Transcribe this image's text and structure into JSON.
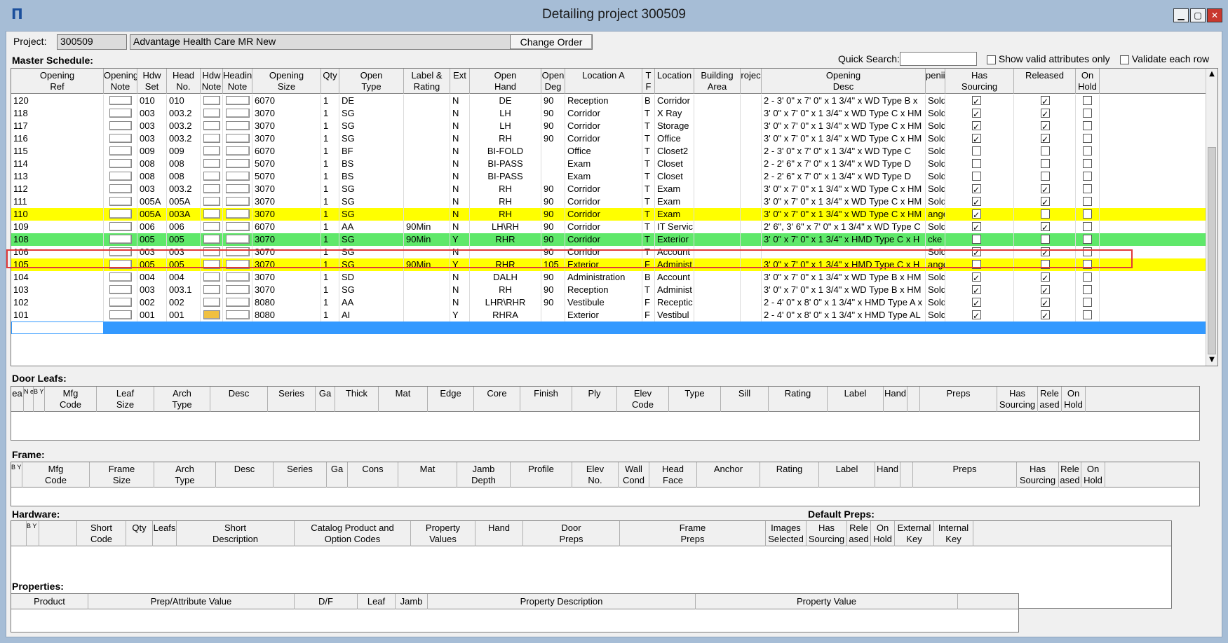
{
  "window": {
    "title": "Detailing project 300509",
    "app_icon": "app-icon",
    "buttons": [
      "minimize",
      "maximize",
      "close"
    ]
  },
  "project": {
    "label": "Project:",
    "number": "300509",
    "name": "Advantage Health Care MR New",
    "change_order_label": "Change Order"
  },
  "master": {
    "label": "Master Schedule:",
    "quick_search_label": "Quick Search:",
    "quick_search_value": "",
    "show_valid_label": "Show valid attributes only",
    "validate_label": "Validate each row",
    "headers": {
      "opening_ref": [
        "Opening",
        "Ref"
      ],
      "opening_note": [
        "Opening",
        "Note"
      ],
      "hdw_set": [
        "Hdw",
        "Set"
      ],
      "head_no": [
        "Head",
        "No."
      ],
      "hdw_note": [
        "Hdw",
        "Note"
      ],
      "heading_note": [
        "Heading",
        "Note"
      ],
      "opening_size": [
        "Opening",
        "Size"
      ],
      "qty": [
        "",
        "Qty"
      ],
      "open_type": [
        "Open",
        "Type"
      ],
      "label_rating": [
        "Label &",
        "Rating"
      ],
      "ext": [
        "",
        "Ext"
      ],
      "open_hand": [
        "Open",
        "Hand"
      ],
      "open_deg": [
        "Open",
        "Deg"
      ],
      "location_a": [
        "",
        "Location A"
      ],
      "tf": [
        "T",
        "F"
      ],
      "location": [
        "",
        "Location"
      ],
      "building_area": [
        "Building",
        "Area"
      ],
      "proj": [
        "rojec",
        ""
      ],
      "opening_desc": [
        "Opening",
        "Desc"
      ],
      "openi": [
        "penii",
        ""
      ],
      "has_sourcing": [
        "Has",
        "Sourcing"
      ],
      "released": [
        "",
        "Released"
      ],
      "on_hold": [
        "On",
        "Hold"
      ]
    },
    "rows": [
      {
        "ref": "120",
        "set": "010",
        "head": "010",
        "size": "6070",
        "qty": "1",
        "type": "DE",
        "label": "",
        "ext": "N",
        "hand": "DE",
        "deg": "90",
        "loca": "Reception",
        "tf": "B",
        "loc": "Corridor",
        "desc": "2 - 3' 0\" x 7' 0\" x 1 3/4\" x WD Type B x",
        "stat": "Sold",
        "src": true,
        "rel": true,
        "hold": false,
        "style": ""
      },
      {
        "ref": "118",
        "set": "003",
        "head": "003.2",
        "size": "3070",
        "qty": "1",
        "type": "SG",
        "label": "",
        "ext": "N",
        "hand": "LH",
        "deg": "90",
        "loca": "Corridor",
        "tf": "T",
        "loc": "X Ray",
        "desc": "3' 0\" x 7' 0\" x 1 3/4\" x WD Type C x HM",
        "stat": "Sold",
        "src": true,
        "rel": true,
        "hold": false,
        "style": ""
      },
      {
        "ref": "117",
        "set": "003",
        "head": "003.2",
        "size": "3070",
        "qty": "1",
        "type": "SG",
        "label": "",
        "ext": "N",
        "hand": "LH",
        "deg": "90",
        "loca": "Corridor",
        "tf": "T",
        "loc": "Storage",
        "desc": "3' 0\" x 7' 0\" x 1 3/4\" x WD Type C x HM",
        "stat": "Sold",
        "src": true,
        "rel": true,
        "hold": false,
        "style": ""
      },
      {
        "ref": "116",
        "set": "003",
        "head": "003.2",
        "size": "3070",
        "qty": "1",
        "type": "SG",
        "label": "",
        "ext": "N",
        "hand": "RH",
        "deg": "90",
        "loca": "Corridor",
        "tf": "T",
        "loc": "Office",
        "desc": "3' 0\" x 7' 0\" x 1 3/4\" x WD Type C x HM",
        "stat": "Sold",
        "src": true,
        "rel": true,
        "hold": false,
        "style": ""
      },
      {
        "ref": "115",
        "set": "009",
        "head": "009",
        "size": "6070",
        "qty": "1",
        "type": "BF",
        "label": "",
        "ext": "N",
        "hand": "BI-FOLD",
        "deg": "",
        "loca": "Office",
        "tf": "T",
        "loc": "Closet2",
        "desc": "2 - 3' 0\" x 7' 0\" x 1 3/4\" x WD Type C",
        "stat": "Sold",
        "src": false,
        "rel": false,
        "hold": false,
        "style": ""
      },
      {
        "ref": "114",
        "set": "008",
        "head": "008",
        "size": "5070",
        "qty": "1",
        "type": "BS",
        "label": "",
        "ext": "N",
        "hand": "BI-PASS",
        "deg": "",
        "loca": "Exam",
        "tf": "T",
        "loc": "Closet",
        "desc": "2 - 2' 6\" x 7' 0\" x 1 3/4\" x WD Type D",
        "stat": "Sold",
        "src": false,
        "rel": false,
        "hold": false,
        "style": ""
      },
      {
        "ref": "113",
        "set": "008",
        "head": "008",
        "size": "5070",
        "qty": "1",
        "type": "BS",
        "label": "",
        "ext": "N",
        "hand": "BI-PASS",
        "deg": "",
        "loca": "Exam",
        "tf": "T",
        "loc": "Closet",
        "desc": "2 - 2' 6\" x 7' 0\" x 1 3/4\" x WD Type D",
        "stat": "Sold",
        "src": false,
        "rel": false,
        "hold": false,
        "style": ""
      },
      {
        "ref": "112",
        "set": "003",
        "head": "003.2",
        "size": "3070",
        "qty": "1",
        "type": "SG",
        "label": "",
        "ext": "N",
        "hand": "RH",
        "deg": "90",
        "loca": "Corridor",
        "tf": "T",
        "loc": "Exam",
        "desc": "3' 0\" x 7' 0\" x 1 3/4\" x WD Type C x HM",
        "stat": "Sold",
        "src": true,
        "rel": true,
        "hold": false,
        "style": ""
      },
      {
        "ref": "111",
        "set": "005A",
        "head": "005A",
        "size": "3070",
        "qty": "1",
        "type": "SG",
        "label": "",
        "ext": "N",
        "hand": "RH",
        "deg": "90",
        "loca": "Corridor",
        "tf": "T",
        "loc": "Exam",
        "desc": "3' 0\" x 7' 0\" x 1 3/4\" x WD Type C x HM",
        "stat": "Sold",
        "src": true,
        "rel": true,
        "hold": false,
        "style": ""
      },
      {
        "ref": "110",
        "set": "005A",
        "head": "003A",
        "size": "3070",
        "qty": "1",
        "type": "SG",
        "label": "",
        "ext": "N",
        "hand": "RH",
        "deg": "90",
        "loca": "Corridor",
        "tf": "T",
        "loc": "Exam",
        "desc": "3' 0\" x 7' 0\" x 1 3/4\" x WD Type C x HM",
        "stat": "ange",
        "src": true,
        "rel": false,
        "hold": false,
        "style": "yellow"
      },
      {
        "ref": "109",
        "set": "006",
        "head": "006",
        "size": "6070",
        "qty": "1",
        "type": "AA",
        "label": "90Min",
        "ext": "N",
        "hand": "LH\\RH",
        "deg": "90",
        "loca": "Corridor",
        "tf": "T",
        "loc": "IT Servic",
        "desc": "2' 6\", 3' 6\" x 7' 0\" x 1 3/4\" x WD Type C",
        "stat": "Sold",
        "src": true,
        "rel": true,
        "hold": false,
        "style": ""
      },
      {
        "ref": "108",
        "set": "005",
        "head": "005",
        "size": "3070",
        "qty": "1",
        "type": "SG",
        "label": "90Min",
        "ext": "Y",
        "hand": "RHR",
        "deg": "90",
        "loca": "Corridor",
        "tf": "T",
        "loc": "Exterior",
        "desc": "3' 0\" x 7' 0\" x 1 3/4\" x HMD Type C x H",
        "stat": "cke",
        "src": false,
        "rel": false,
        "hold": false,
        "style": "green"
      },
      {
        "ref": "106",
        "set": "003",
        "head": "003",
        "size": "3070",
        "qty": "1",
        "type": "SG",
        "label": "",
        "ext": "N",
        "hand": "",
        "deg": "90",
        "loca": "Corridor",
        "tf": "T",
        "loc": "Account",
        "desc": "",
        "stat": "Sold",
        "src": true,
        "rel": true,
        "hold": false,
        "style": ""
      },
      {
        "ref": "105",
        "set": "005",
        "head": "005",
        "size": "3070",
        "qty": "1",
        "type": "SG",
        "label": "90Min",
        "ext": "Y",
        "hand": "RHR",
        "deg": "105",
        "loca": "Exterior",
        "tf": "F",
        "loc": "Administ",
        "desc": "3' 0\" x 7' 0\" x 1 3/4\" x HMD Type C x H",
        "stat": "ange",
        "src": false,
        "rel": false,
        "hold": false,
        "style": "yellow"
      },
      {
        "ref": "104",
        "set": "004",
        "head": "004",
        "size": "3070",
        "qty": "1",
        "type": "SD",
        "label": "",
        "ext": "N",
        "hand": "DALH",
        "deg": "90",
        "loca": "Administration",
        "tf": "B",
        "loc": "Account",
        "desc": "3' 0\" x 7' 0\" x 1 3/4\" x WD Type B x HM",
        "stat": "Sold",
        "src": true,
        "rel": true,
        "hold": false,
        "style": ""
      },
      {
        "ref": "103",
        "set": "003",
        "head": "003.1",
        "size": "3070",
        "qty": "1",
        "type": "SG",
        "label": "",
        "ext": "N",
        "hand": "RH",
        "deg": "90",
        "loca": "Reception",
        "tf": "T",
        "loc": "Administ",
        "desc": "3' 0\" x 7' 0\" x 1 3/4\" x WD Type B x HM",
        "stat": "Sold",
        "src": true,
        "rel": true,
        "hold": false,
        "style": ""
      },
      {
        "ref": "102",
        "set": "002",
        "head": "002",
        "size": "8080",
        "qty": "1",
        "type": "AA",
        "label": "",
        "ext": "N",
        "hand": "LHR\\RHR",
        "deg": "90",
        "loca": "Vestibule",
        "tf": "F",
        "loc": "Receptic",
        "desc": "2 - 4' 0\" x 8' 0\" x 1 3/4\" x HMD Type A x",
        "stat": "Sold",
        "src": true,
        "rel": true,
        "hold": false,
        "style": ""
      },
      {
        "ref": "101",
        "set": "001",
        "head": "001",
        "size": "8080",
        "qty": "1",
        "type": "AI",
        "label": "",
        "ext": "Y",
        "hand": "RHRA",
        "deg": "",
        "loca": "Exterior",
        "tf": "F",
        "loc": "Vestibul",
        "desc": "2 - 4' 0\" x 8' 0\" x 1 3/4\" x HMD Type AL",
        "stat": "Sold",
        "src": true,
        "rel": true,
        "hold": false,
        "style": ""
      }
    ]
  },
  "door_leafs": {
    "label": "Door Leafs:",
    "headers": [
      [
        "ea",
        ""
      ],
      [
        "N e t",
        ""
      ],
      [
        "B Y O",
        ""
      ],
      [
        "Mfg",
        "Code"
      ],
      [
        "Leaf",
        "Size"
      ],
      [
        "Arch",
        "Type"
      ],
      [
        "",
        "Desc"
      ],
      [
        "",
        "Series"
      ],
      [
        "",
        "Ga"
      ],
      [
        "",
        "Thick"
      ],
      [
        "",
        "Mat"
      ],
      [
        "",
        "Edge"
      ],
      [
        "",
        "Core"
      ],
      [
        "",
        "Finish"
      ],
      [
        "",
        "Ply"
      ],
      [
        "Elev",
        "Code"
      ],
      [
        "",
        "Type"
      ],
      [
        "",
        "Sill"
      ],
      [
        "",
        "Rating"
      ],
      [
        "",
        "Label"
      ],
      [
        "",
        "Hand"
      ],
      [
        "",
        ""
      ],
      [
        "",
        "Preps"
      ],
      [
        "Has",
        "Sourcing"
      ],
      [
        "Rele",
        "ased"
      ],
      [
        "On",
        "Hold"
      ]
    ]
  },
  "frame": {
    "label": "Frame:",
    "headers": [
      [
        "B Y O",
        ""
      ],
      [
        "Mfg",
        "Code"
      ],
      [
        "Frame",
        "Size"
      ],
      [
        "Arch",
        "Type"
      ],
      [
        "",
        "Desc"
      ],
      [
        "",
        "Series"
      ],
      [
        "",
        "Ga"
      ],
      [
        "",
        "Cons"
      ],
      [
        "",
        "Mat"
      ],
      [
        "Jamb",
        "Depth"
      ],
      [
        "",
        "Profile"
      ],
      [
        "Elev",
        "No."
      ],
      [
        "Wall",
        "Cond"
      ],
      [
        "Head",
        "Face"
      ],
      [
        "",
        "Anchor"
      ],
      [
        "",
        "Rating"
      ],
      [
        "",
        "Label"
      ],
      [
        "",
        "Hand"
      ],
      [
        "",
        ""
      ],
      [
        "",
        "Preps"
      ],
      [
        "Has",
        "Sourcing"
      ],
      [
        "Rele",
        "ased"
      ],
      [
        "On",
        "Hold"
      ]
    ]
  },
  "hardware": {
    "label": "Hardware:",
    "default_preps_label": "Default Preps:",
    "headers": [
      [
        "",
        ""
      ],
      [
        "B Y O",
        ""
      ],
      [
        "",
        ""
      ],
      [
        "Short",
        "Code"
      ],
      [
        "",
        "Qty"
      ],
      [
        "",
        "Leafs"
      ],
      [
        "Short",
        "Description"
      ],
      [
        "Catalog Product and",
        "Option Codes"
      ],
      [
        "Property",
        "Values"
      ],
      [
        "",
        "Hand"
      ],
      [
        "Door",
        "Preps"
      ],
      [
        "Frame",
        "Preps"
      ],
      [
        "Images",
        "Selected"
      ],
      [
        "Has",
        "Sourcing"
      ],
      [
        "Rele",
        "ased"
      ],
      [
        "On",
        "Hold"
      ],
      [
        "External",
        "Key"
      ],
      [
        "Internal",
        "Key"
      ]
    ]
  },
  "properties": {
    "label": "Properties:",
    "headers": [
      "Product",
      "Prep/Attribute Value",
      "D/F",
      "Leaf",
      "Jamb",
      "Property Description",
      "Property Value"
    ]
  }
}
